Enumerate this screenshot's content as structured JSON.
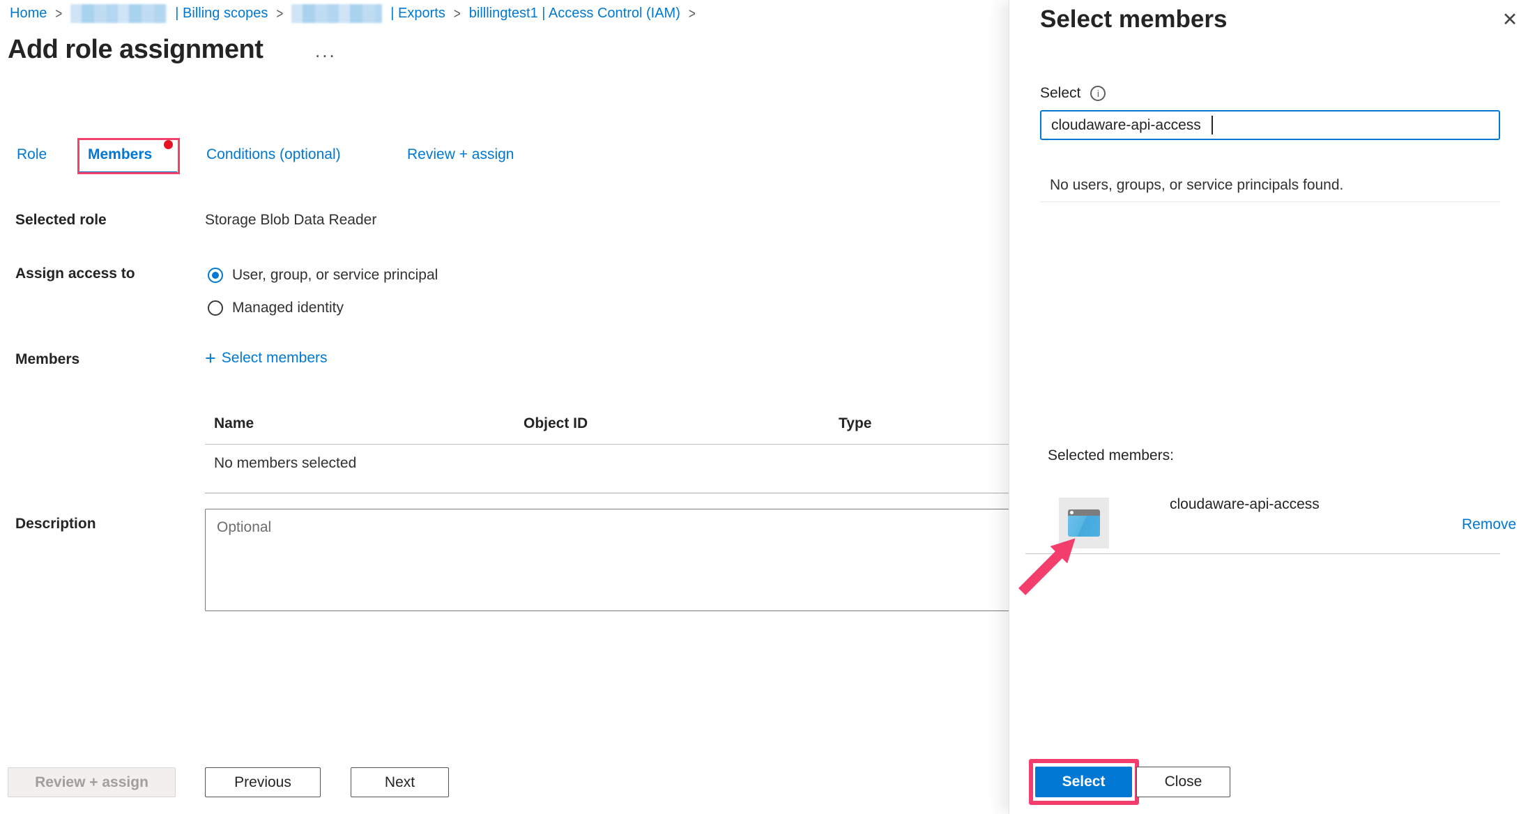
{
  "colors": {
    "accent": "#0078d4",
    "annotation_pink": "#f33e6d",
    "red_dot": "#e81123"
  },
  "breadcrumb": {
    "home": "Home",
    "separator": ">",
    "billing_scopes": "| Billing scopes",
    "exports": "| Exports",
    "iam": "billlingtest1 | Access Control (IAM)"
  },
  "header": {
    "title": "Add role assignment",
    "more": "..."
  },
  "tabs": {
    "role": "Role",
    "members": "Members",
    "conditions": "Conditions (optional)",
    "review": "Review + assign"
  },
  "form": {
    "selected_role_label": "Selected role",
    "selected_role_value": "Storage Blob Data Reader",
    "assign_access_label": "Assign access to",
    "option_user_group": "User, group, or service principal",
    "option_managed_identity": "Managed identity",
    "members_label": "Members",
    "plus": "+",
    "select_members_link": "Select members",
    "table": {
      "headers": [
        "Name",
        "Object ID",
        "Type"
      ],
      "empty": "No members selected"
    },
    "description_label": "Description",
    "description_placeholder": "Optional"
  },
  "footer": {
    "review_assign": "Review + assign",
    "previous": "Previous",
    "next": "Next"
  },
  "panel": {
    "title": "Select members",
    "close_icon": "✕",
    "select_label": "Select",
    "info_icon": "i",
    "search_value": "cloudaware-api-access",
    "no_results": "No users, groups, or service principals found.",
    "selected_members_label": "Selected members:",
    "member": {
      "name": "cloudaware-api-access",
      "remove": "Remove"
    },
    "select_button": "Select",
    "close_button": "Close"
  }
}
